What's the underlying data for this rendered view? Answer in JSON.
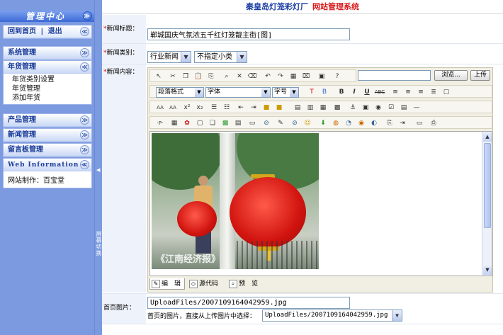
{
  "header": {
    "site_name": "秦皇岛灯笼彩灯厂",
    "system_name": "网站管理系统"
  },
  "sidebar": {
    "title": "管理中心",
    "home_label": "回到首页",
    "separator": "|",
    "logout_label": "退出",
    "sections": [
      {
        "label": "系统管理",
        "toggle": "≫"
      },
      {
        "label": "年货管理",
        "toggle": "≪",
        "items": [
          "年货类别设置",
          "年货管理",
          "添加年货"
        ]
      },
      {
        "label": "产品管理",
        "toggle": "≫"
      },
      {
        "label": "新闻管理",
        "toggle": "≫"
      },
      {
        "label": "留言板管理",
        "toggle": "≫"
      },
      {
        "label": "Web Information",
        "toggle": "≪"
      }
    ],
    "credit": "网站制作：百宝堂",
    "top_toggle": "≫",
    "home_toggle": "≪"
  },
  "splitter": {
    "label": "屏幕切换",
    "arrow": "◀"
  },
  "form": {
    "title_label": "新闻标题：",
    "title_value": "郸城国庆气氛浓五千红灯笼靓主街[图]",
    "category_label": "新闻类别：",
    "category_value": "行业新闻",
    "subcategory_value": "不指定小类",
    "content_label": "新闻内容：",
    "thumb_label": "首页图片：",
    "thumb_value": "UploadFiles/2007109164042959.jpg",
    "thumb_hint": "首页的图片，直接从上传图片中选择：",
    "thumb_select_value": "UploadFiles/2007109164042959.jpg"
  },
  "editor": {
    "browse_label": "浏览...",
    "upload_label": "上传",
    "format_select": "段落格式",
    "font_select": "字体",
    "size_select": "字号",
    "photo_watermark": "《江南经济报》",
    "modes": [
      "编　辑",
      "源代码",
      "预　览"
    ]
  }
}
